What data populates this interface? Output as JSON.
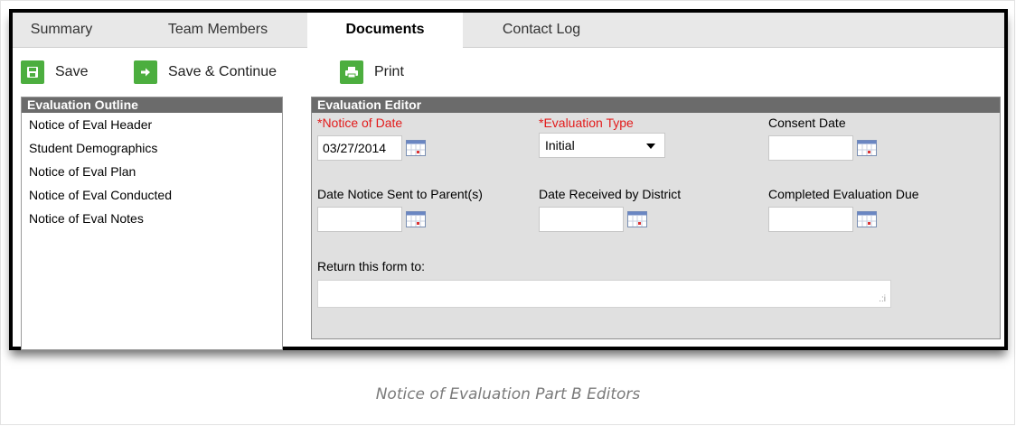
{
  "tabs": [
    {
      "label": "Summary"
    },
    {
      "label": "Team Members"
    },
    {
      "label": "Documents"
    },
    {
      "label": "Contact Log"
    }
  ],
  "toolbar": {
    "save_label": "Save",
    "save_continue_label": "Save & Continue",
    "print_label": "Print"
  },
  "outline": {
    "title": "Evaluation Outline",
    "items": [
      {
        "label": "Notice of Eval Header"
      },
      {
        "label": "Student Demographics"
      },
      {
        "label": "Notice of Eval Plan"
      },
      {
        "label": "Notice of Eval Conducted"
      },
      {
        "label": "Notice of Eval Notes"
      }
    ]
  },
  "editor": {
    "title": "Evaluation Editor",
    "notice_of_date": {
      "label": "*Notice of Date",
      "value": "03/27/2014"
    },
    "evaluation_type": {
      "label": "*Evaluation Type",
      "value": "Initial"
    },
    "consent_date": {
      "label": "Consent Date",
      "value": ""
    },
    "date_notice_sent": {
      "label": "Date Notice Sent to Parent(s)",
      "value": ""
    },
    "date_received": {
      "label": "Date Received by District",
      "value": ""
    },
    "completed_due": {
      "label": "Completed Evaluation Due",
      "value": ""
    },
    "return_form": {
      "label": "Return this form to:",
      "value": ""
    }
  },
  "caption": "Notice of Evaluation Part B Editors",
  "colors": {
    "accent_green": "#4cae3f",
    "required_red": "#e21b1b",
    "panel_header": "#6b6b6b",
    "editor_bg": "#e0e0e0"
  }
}
